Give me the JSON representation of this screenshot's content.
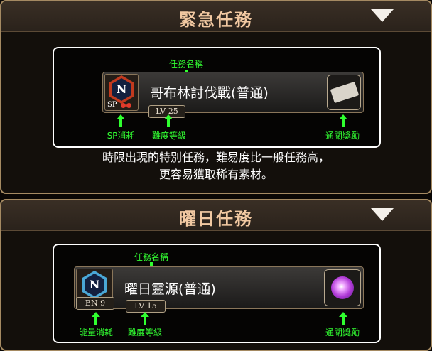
{
  "colors": {
    "accent_title": "#f2c9a2",
    "annotation": "#32ff32",
    "border": "#a58a62"
  },
  "emergency": {
    "title": "緊急任務",
    "collapse_icon": "triangle-down-icon",
    "mission_name": "哥布林討伐戰(普通)",
    "level": "LV 25",
    "cost_label": "SP",
    "badge_icon": "n-hexagon-icon",
    "reward_icon": "gacha-ticket-icon",
    "ann_name": "任務名稱",
    "ann_cost": "SP消耗",
    "ann_level": "難度等級",
    "ann_reward": "通關獎勵",
    "desc_line1": "時限出現的特別任務，難易度比一般任務高，",
    "desc_line2": "更容易獲取稀有素材。"
  },
  "daily": {
    "title": "曜日任務",
    "collapse_icon": "triangle-down-icon",
    "mission_name": "曜日靈源(普通)",
    "level": "LV 15",
    "cost_label": "EN 9",
    "badge_icon": "n-hexagon-icon",
    "reward_icon": "spirit-orb-icon",
    "ann_name": "任務名稱",
    "ann_cost": "能量消耗",
    "ann_level": "難度等級",
    "ann_reward": "通關獎勵"
  }
}
